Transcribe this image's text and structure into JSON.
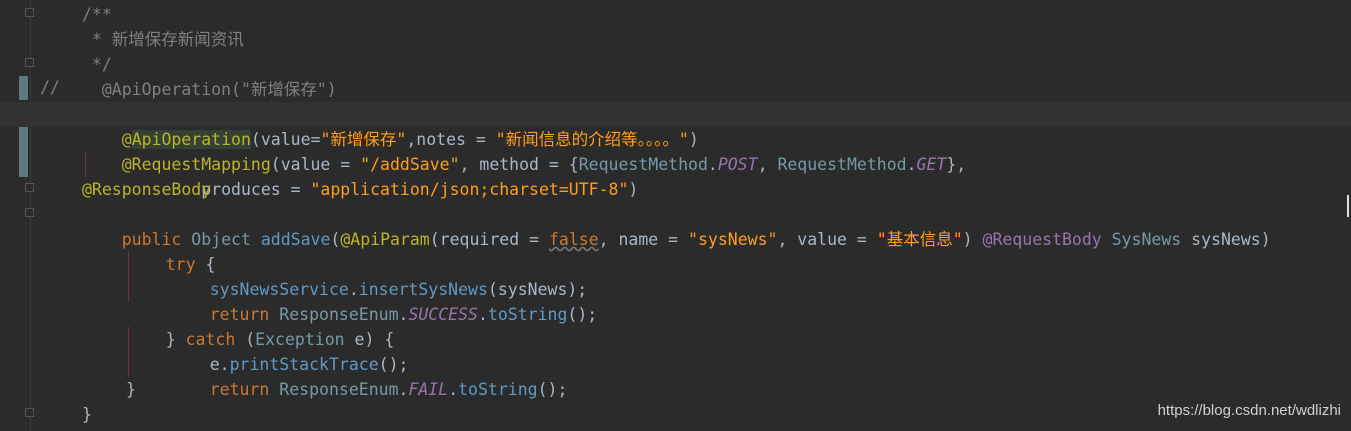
{
  "gutter": {
    "comment_prefix": "//"
  },
  "code": {
    "l1": "/**",
    "l2": " * 新增保存新闻资讯",
    "l3": " */",
    "l4_ann": "  @ApiOperation(\"新增保存\")",
    "l5": {
      "at": "@",
      "ann": "ApiOperation",
      "p1": "(value=",
      "s1": "\"新增保存\"",
      "p2": ",notes = ",
      "s2": "\"新闻信息的介绍等。。。。\"",
      "p3": ")"
    },
    "l6": {
      "ann": "@RequestMapping",
      "p1": "(value = ",
      "s1": "\"/addSave\"",
      "p2": ", method = {",
      "c1": "RequestMethod",
      "d1": ".",
      "k1": "POST",
      "p3": ", ",
      "c2": "RequestMethod",
      "d2": ".",
      "k2": "GET",
      "p4": "},"
    },
    "l7": {
      "p1": "        produces = ",
      "s1": "\"application/json;charset=UTF-8\"",
      "p2": ")"
    },
    "l8": "@ResponseBody",
    "l9": {
      "kw": "public",
      "cls": " Object ",
      "m": "addSave",
      "p1": "(",
      "ann": "@ApiParam",
      "p2": "(required = ",
      "kw2": "false",
      "p3": ", name = ",
      "s1": "\"sysNews\"",
      "p4": ", value = ",
      "s2": "\"基本信息\"",
      "p5": ") ",
      "ann2": "@RequestBody",
      "cls2": " SysNews ",
      "p6": "sysNews)"
    },
    "l10": {
      "kw": "try",
      "p": " {"
    },
    "l11": {
      "f": "sysNewsService",
      "d": ".",
      "m": "insertSysNews",
      "p": "(sysNews);"
    },
    "l12": {
      "kw": "return",
      "cls": " ResponseEnum",
      "d": ".",
      "k": "SUCCESS",
      "d2": ".",
      "m": "toString",
      "p": "();"
    },
    "l13": {
      "p1": "} ",
      "kw": "catch",
      "p2": " (",
      "cls": "Exception",
      "p3": " e) {"
    },
    "l14": {
      "p1": "e.",
      "m": "printStackTrace",
      "p2": "();"
    },
    "l15": {
      "kw": "return",
      "cls": " ResponseEnum",
      "d": ".",
      "k": "FAIL",
      "d2": ".",
      "m": "toString",
      "p": "();"
    },
    "l16": "}",
    "l17": "}"
  },
  "watermark": "https://blog.csdn.net/wdlizhi",
  "icons": {
    "bulb": "lightbulb-icon"
  }
}
